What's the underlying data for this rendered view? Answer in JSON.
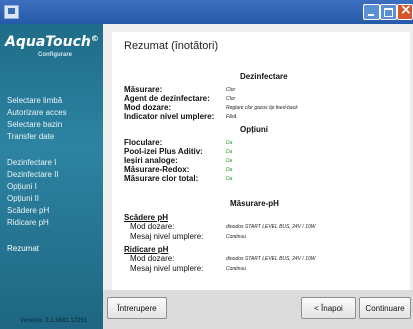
{
  "window": {
    "title": ""
  },
  "sidebar": {
    "logo": "AquaTouch",
    "logo_sub": "Configurare",
    "items": [
      {
        "label": "Selectare limbă"
      },
      {
        "label": "Autorizare acces"
      },
      {
        "label": "Selectare bazin"
      },
      {
        "label": "Transfer date"
      },
      {
        "label": "Dezinfectare I"
      },
      {
        "label": "Dezinfectare II"
      },
      {
        "label": "Opțiuni I"
      },
      {
        "label": "Opțiuni II"
      },
      {
        "label": "Scădere pH"
      },
      {
        "label": "Ridicare pH"
      },
      {
        "label": "Rezumat"
      }
    ],
    "version": "Version: 2.3.5881.17251"
  },
  "summary": {
    "title": "Rezumat (înotători)",
    "sections": {
      "dezinfectare": {
        "heading": "Dezinfectare",
        "rows": [
          {
            "label": "Măsurare:",
            "value": "Clor"
          },
          {
            "label": "Agent de dezinfectare:",
            "value": "Clor"
          },
          {
            "label": "Mod dozare:",
            "value": "Reglare clor gazos tip feed-back"
          },
          {
            "label": "Indicator nivel umplere:",
            "value": "Fără"
          }
        ]
      },
      "optiuni": {
        "heading": "Opțiuni",
        "rows": [
          {
            "label": "Floculare:",
            "value": "Da"
          },
          {
            "label": "Pool-izei Plus Aditiv:",
            "value": "Da"
          },
          {
            "label": "Ieșiri analoge:",
            "value": "Da"
          },
          {
            "label": "Măsurare-Redox:",
            "value": "Da"
          },
          {
            "label": "Măsurare clor total:",
            "value": "Da"
          }
        ]
      },
      "masurare_ph": {
        "heading": "Măsurare-pH",
        "scadere": {
          "heading": "Scădere pH",
          "rows": [
            {
              "label": "Mod dozare:",
              "value": "dinodos START LEVEL BUS, 24V / 10W"
            },
            {
              "label": "Mesaj nivel umplere:",
              "value": "Continuu"
            }
          ]
        },
        "ridicare": {
          "heading": "Ridicare pH",
          "rows": [
            {
              "label": "Mod dozare:",
              "value": "dinodos START LEVEL BUS, 24V / 10W"
            },
            {
              "label": "Mesaj nivel umplere:",
              "value": "Continuu"
            }
          ]
        }
      }
    }
  },
  "footer": {
    "cancel": "Întrerupere",
    "back": "< Înapoi",
    "next": "Continuare"
  },
  "colors": {
    "sidebar": "#2d84a2",
    "titlebar": "#245aa8",
    "yes_value": "#2a9a2a"
  }
}
